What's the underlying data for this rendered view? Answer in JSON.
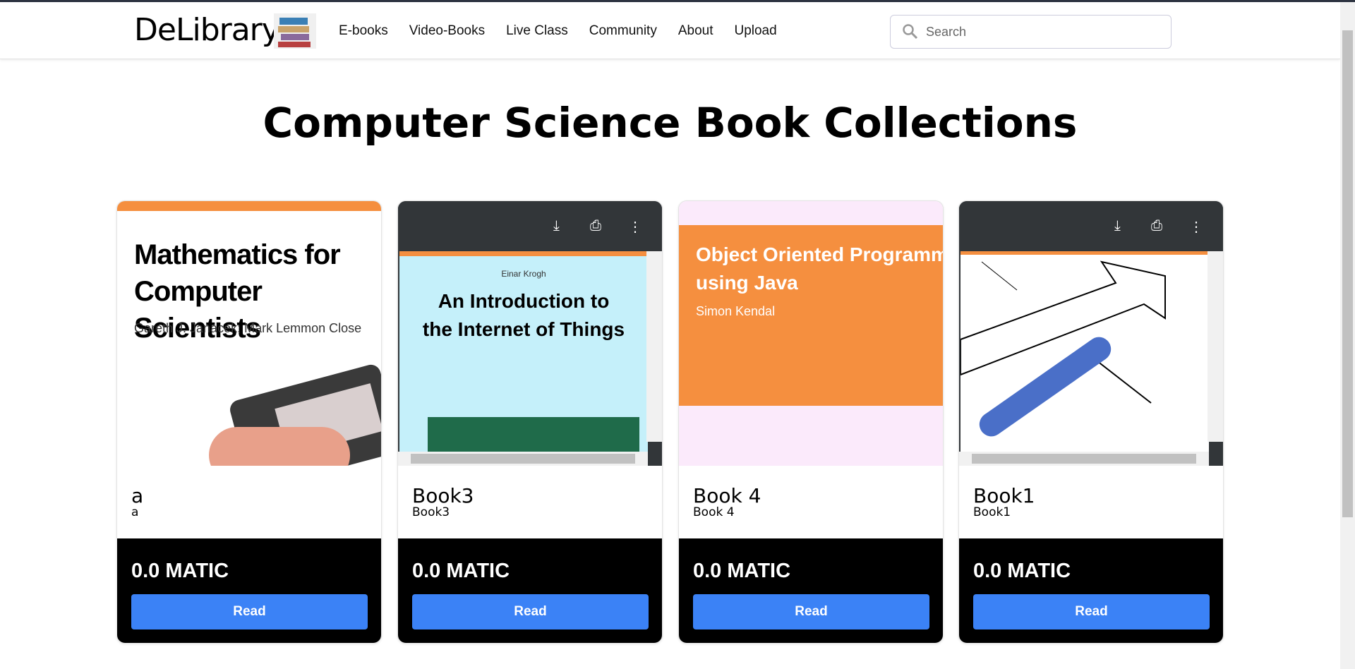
{
  "nav": {
    "logo": "DeLibrary",
    "links": [
      "E-books",
      "Video-Books",
      "Live Class",
      "Community",
      "About",
      "Upload"
    ],
    "search_placeholder": "Search"
  },
  "page_title": "Computer Science Book Collections",
  "books": [
    {
      "name": "a",
      "description": "a",
      "price": "0.0 MATIC",
      "read": "Read",
      "cover_title": "Mathematics for Computer Scientists",
      "cover_author": "Gareth J. Janacek; Mark Lemmon Close"
    },
    {
      "name": "Book3",
      "description": "Book3",
      "price": "0.0 MATIC",
      "read": "Read",
      "cover_title": "An Introduction to the Internet of Things",
      "cover_author": "Einar Krogh"
    },
    {
      "name": "Book 4",
      "description": "Book 4",
      "price": "0.0 MATIC",
      "read": "Read",
      "cover_title": "Object Oriented Programming using Java",
      "cover_author": "Simon Kendal"
    },
    {
      "name": "Book1",
      "description": "Book1",
      "price": "0.0 MATIC",
      "read": "Read"
    }
  ],
  "colors": {
    "accent": "#3b82f6",
    "orange": "#f58f3f",
    "pdf_toolbar": "#323639"
  }
}
